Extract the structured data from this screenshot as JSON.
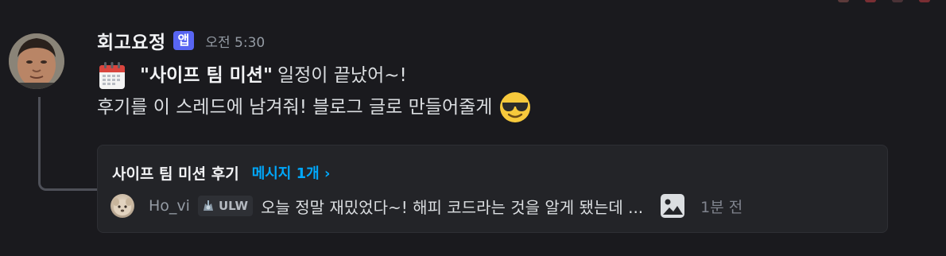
{
  "message": {
    "author": "회고요정",
    "app_badge": "앱",
    "timestamp": "오전 5:30",
    "line1_bold": "\"사이프 팀 미션\"",
    "line1_rest": "일정이 끝났어~!",
    "line2": "후기를 이 스레드에 남겨줘! 블로그 글로 만들어줄게"
  },
  "thread": {
    "name": "사이프 팀 미션 후기",
    "count_label": "메시지 1개 ›",
    "last_message": {
      "user": "Ho_vi",
      "role": "ULW",
      "text": "오늘 정말 재밌었다~! 해피 코드라는 것을 알게 됐는데 ...",
      "time": "1분 전"
    }
  },
  "icons": {
    "calendar": "calendar-emoji",
    "sunglasses": "smiling-face-with-sunglasses-emoji",
    "image": "image-attachment-icon"
  },
  "colors": {
    "background": "#1a1a1e",
    "card": "#232428",
    "app_badge": "#5865f2",
    "link": "#00a8fc"
  }
}
